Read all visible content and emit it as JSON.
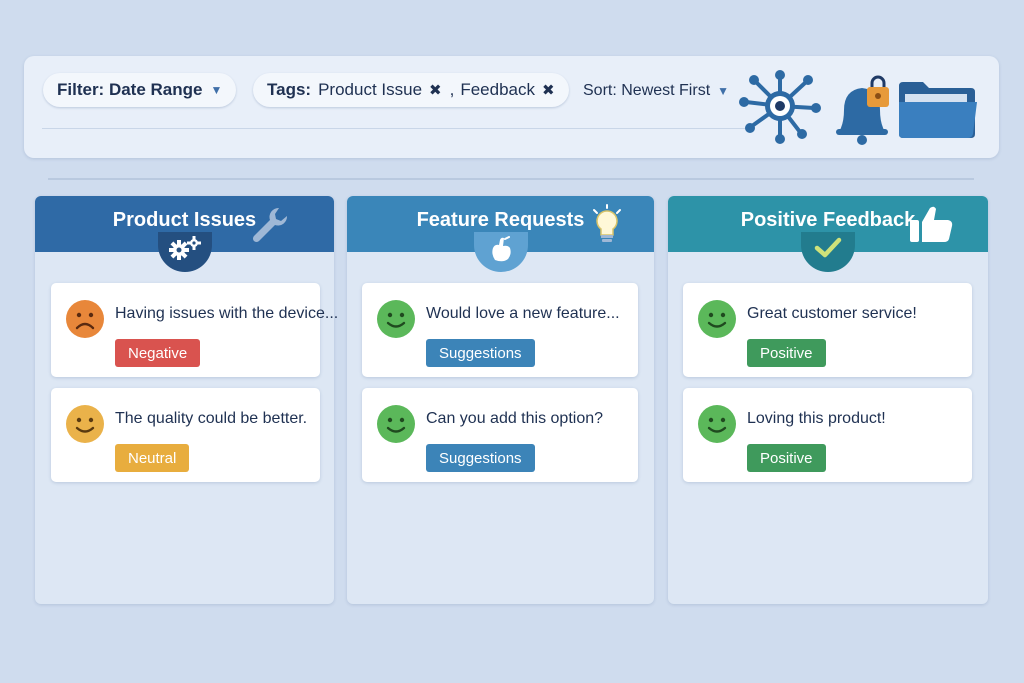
{
  "toolbar": {
    "filter": {
      "label": "Filter: Date Range"
    },
    "tags": {
      "label": "Tags:",
      "items": [
        "Product Issue",
        "Feedback"
      ],
      "separator": ","
    },
    "sort": {
      "label": "Sort: Newest First"
    },
    "icons": [
      "network-icon",
      "bell-lock-icon",
      "folder-icon"
    ]
  },
  "colors": {
    "product_head": "#2f6aa6",
    "feature_head": "#3a86b9",
    "positive_head": "#2d93a8",
    "negative": "#d9534f",
    "neutral": "#e8ad3e",
    "suggestions": "#3c84b8",
    "positive": "#3f9a5c"
  },
  "columns": [
    {
      "title": "Product Issues",
      "head_icon": "wrench-icon",
      "badge_icon": "gears-icon",
      "cards": [
        {
          "text": "Having issues with the device...",
          "face": "sad-face-icon",
          "tag": "Negative"
        },
        {
          "text": "The quality could be better.",
          "face": "smile-face-icon",
          "tag": "Neutral"
        }
      ]
    },
    {
      "title": "Feature Requests",
      "head_icon": "lightbulb-icon",
      "badge_icon": "hand-icon",
      "cards": [
        {
          "text": "Would love a new feature...",
          "face": "smile-face-icon",
          "tag": "Suggestions"
        },
        {
          "text": "Can you add this option?",
          "face": "smile-face-icon",
          "tag": "Suggestions"
        }
      ]
    },
    {
      "title": "Positive Feedback",
      "head_icon": "thumbs-up-icon",
      "badge_icon": "checkmark-icon",
      "cards": [
        {
          "text": "Great customer service!",
          "face": "smile-face-icon",
          "tag": "Positive"
        },
        {
          "text": "Loving this product!",
          "face": "smile-face-icon",
          "tag": "Positive"
        }
      ]
    }
  ]
}
